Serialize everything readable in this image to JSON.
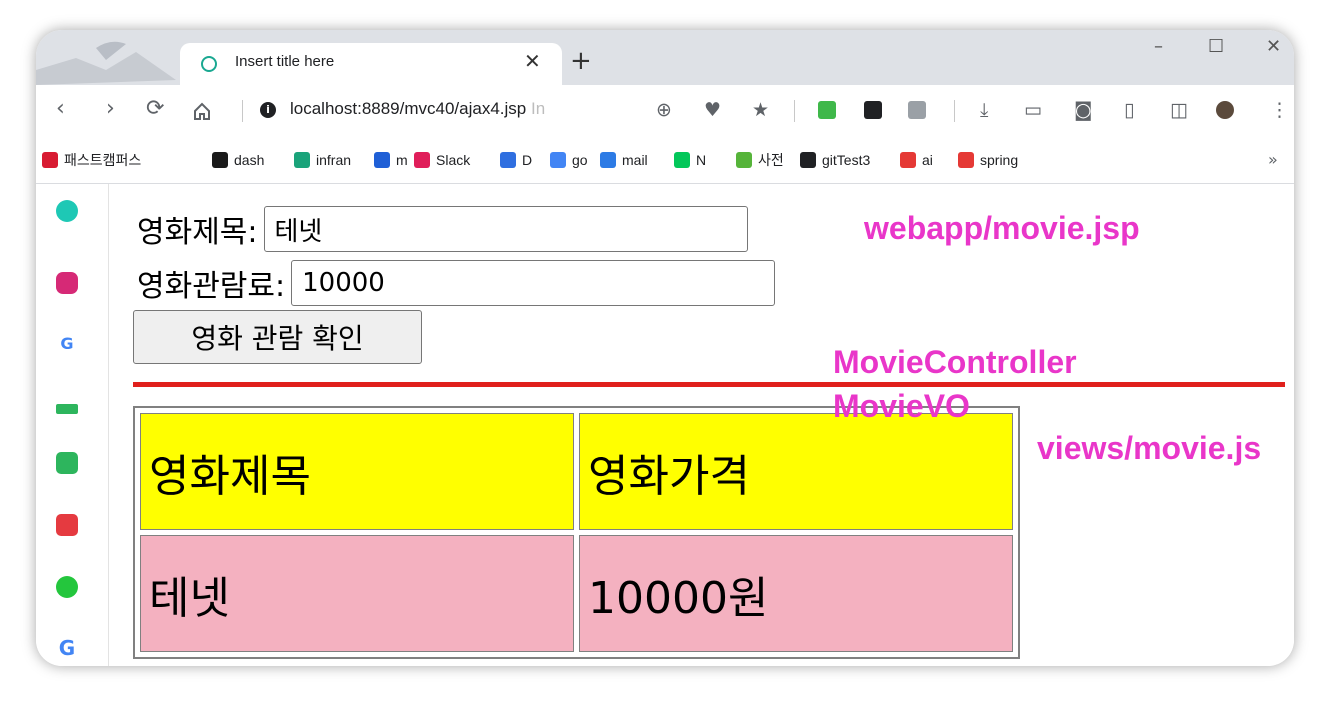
{
  "browser": {
    "tab_title": "Insert title here",
    "url_main": "localhost:8889/mvc40/ajax4.jsp",
    "url_faded": "In",
    "new_tab": "+",
    "close_tab": "✕",
    "window_controls": [
      "–",
      "☐",
      "✕"
    ],
    "bookmarks": [
      {
        "label": "패스트캠퍼스",
        "color": "#d81b32"
      },
      {
        "label": "dash",
        "color": "#1a1a1a"
      },
      {
        "label": "infran",
        "color": "#1aa37a"
      },
      {
        "label": "m",
        "color": "#1f5fd6"
      },
      {
        "label": "Slack",
        "color": "#e01e5a"
      },
      {
        "label": "D",
        "color": "#2f6fe0"
      },
      {
        "label": "go",
        "color": "#4285f4"
      },
      {
        "label": "mail",
        "color": "#2d7be5"
      },
      {
        "label": "N",
        "color": "#03c75a"
      },
      {
        "label": "사전",
        "color": "#56b43a"
      },
      {
        "label": "gitTest3",
        "color": "#202124"
      },
      {
        "label": "ai",
        "color": "#e53935"
      },
      {
        "label": "spring",
        "color": "#e53935"
      }
    ],
    "bookmarks_more": "»"
  },
  "form": {
    "title_label": "영화제목:",
    "title_value": "테넷",
    "price_label": "영화관람료:",
    "price_value": "10000",
    "submit_label": "영화 관람 확인"
  },
  "table": {
    "headers": [
      "영화제목",
      "영화가격"
    ],
    "rows": [
      [
        "테넷",
        "10000원"
      ]
    ]
  },
  "annotations": {
    "webapp": "webapp/movie.jsp",
    "controller": "MovieController",
    "vo": "MovieVO",
    "views": "views/movie.js"
  },
  "colors": {
    "annotation": "#e936c9",
    "divider": "#e0201c",
    "header_bg": "#ffff00",
    "row_bg": "#f4b1c0"
  }
}
